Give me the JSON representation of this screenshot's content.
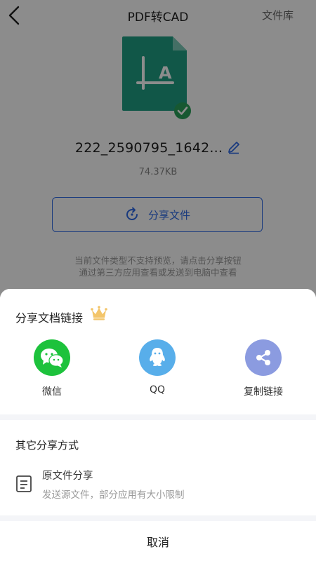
{
  "header": {
    "title": "PDF转CAD",
    "library_label": "文件库"
  },
  "file": {
    "name": "222_2590795_1642...",
    "size": "74.37KB",
    "share_button_label": "分享文件",
    "hint_line1": "当前文件类型不支持预览，请点击分享按钮",
    "hint_line2": "通过第三方应用查看或发送到电脑中查看"
  },
  "share_sheet": {
    "link_section_title": "分享文档链接",
    "items": [
      {
        "label": "微信",
        "icon": "wechat-icon",
        "color": "#1dc23c"
      },
      {
        "label": "QQ",
        "icon": "qq-icon",
        "color": "#58aeea"
      },
      {
        "label": "复制链接",
        "icon": "share-link-icon",
        "color": "#8b9be0"
      }
    ],
    "other_section_title": "其它分享方式",
    "original_share": {
      "title": "原文件分享",
      "subtitle": "发送源文件，部分应用有大小限制"
    },
    "cancel_label": "取消"
  },
  "colors": {
    "accent": "#2e6be6",
    "file_icon": "#1f9e84",
    "check": "#2aa15a",
    "crown": "#f3c56a"
  }
}
